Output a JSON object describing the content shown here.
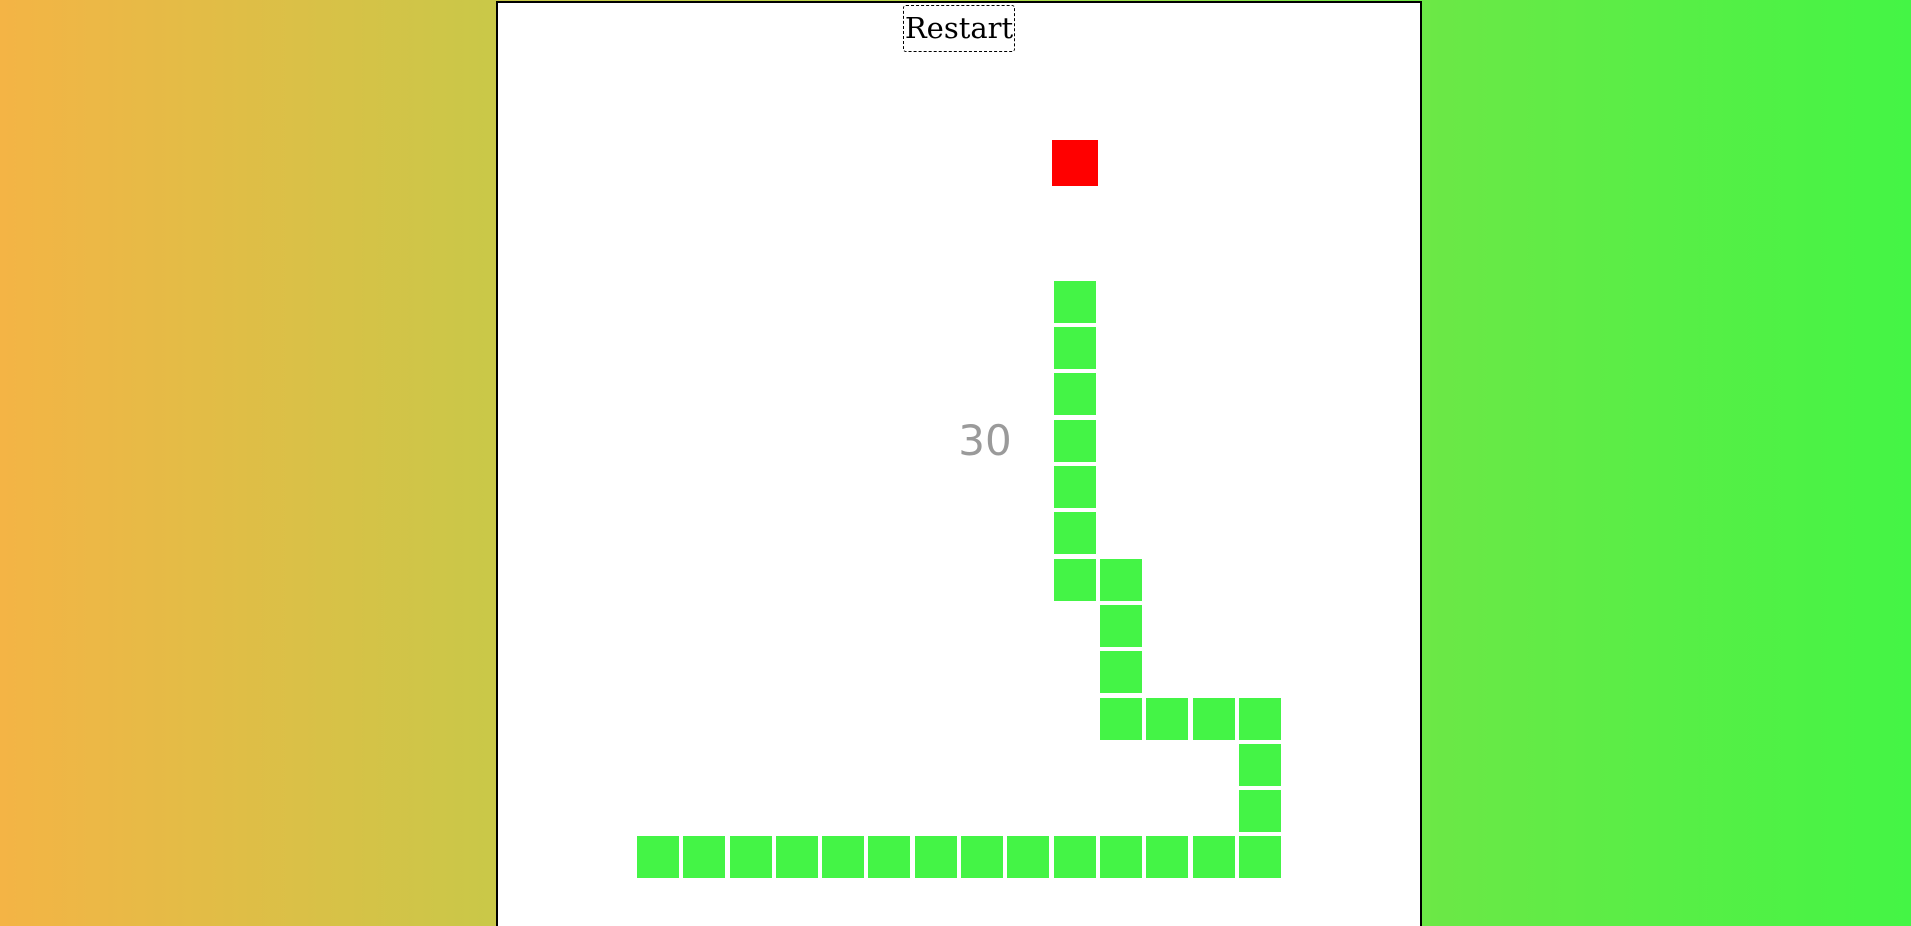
{
  "game": {
    "restart_label": "Restart",
    "score": "30",
    "colors": {
      "snake": "#44f446",
      "food": "#ff0000",
      "board": "#ffffff",
      "score_text": "#9a9a9a"
    },
    "grid": {
      "cols": 20,
      "rows": 20
    },
    "food": {
      "col": 12,
      "row": 3
    },
    "snake": [
      {
        "col": 12,
        "row": 6
      },
      {
        "col": 12,
        "row": 7
      },
      {
        "col": 12,
        "row": 8
      },
      {
        "col": 12,
        "row": 9
      },
      {
        "col": 12,
        "row": 10
      },
      {
        "col": 12,
        "row": 11
      },
      {
        "col": 12,
        "row": 12
      },
      {
        "col": 13,
        "row": 12
      },
      {
        "col": 13,
        "row": 13
      },
      {
        "col": 13,
        "row": 14
      },
      {
        "col": 13,
        "row": 15
      },
      {
        "col": 14,
        "row": 15
      },
      {
        "col": 15,
        "row": 15
      },
      {
        "col": 16,
        "row": 15
      },
      {
        "col": 16,
        "row": 16
      },
      {
        "col": 16,
        "row": 17
      },
      {
        "col": 16,
        "row": 18
      },
      {
        "col": 15,
        "row": 18
      },
      {
        "col": 14,
        "row": 18
      },
      {
        "col": 13,
        "row": 18
      },
      {
        "col": 12,
        "row": 18
      },
      {
        "col": 11,
        "row": 18
      },
      {
        "col": 10,
        "row": 18
      },
      {
        "col": 9,
        "row": 18
      },
      {
        "col": 8,
        "row": 18
      },
      {
        "col": 7,
        "row": 18
      },
      {
        "col": 6,
        "row": 18
      },
      {
        "col": 5,
        "row": 18
      },
      {
        "col": 4,
        "row": 18
      },
      {
        "col": 3,
        "row": 18
      }
    ]
  }
}
